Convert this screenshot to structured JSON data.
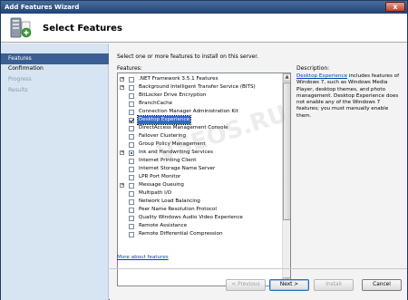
{
  "window": {
    "title": "Add Features Wizard",
    "close_glyph": "x"
  },
  "header": {
    "title": "Select Features",
    "icon": "server-add-feature-icon"
  },
  "nav": {
    "items": [
      {
        "label": "Features",
        "state": "active"
      },
      {
        "label": "Confirmation",
        "state": "normal"
      },
      {
        "label": "Progress",
        "state": "disabled"
      },
      {
        "label": "Results",
        "state": "disabled"
      }
    ]
  },
  "content": {
    "intro": "Select one or more features to install on this server.",
    "features_label": "Features:",
    "description_label": "Description:",
    "features": [
      {
        "label": ".NET Framework 3.5.1 Features",
        "expandable": true,
        "checked": false
      },
      {
        "label": "Background Intelligent Transfer Service (BITS)",
        "expandable": true,
        "checked": false
      },
      {
        "label": "BitLocker Drive Encryption",
        "expandable": false,
        "checked": false
      },
      {
        "label": "BranchCache",
        "expandable": false,
        "checked": false
      },
      {
        "label": "Connection Manager Administration Kit",
        "expandable": false,
        "checked": false
      },
      {
        "label": "Desktop Experience",
        "expandable": false,
        "checked": true,
        "selected": true
      },
      {
        "label": "DirectAccess Management Console",
        "expandable": false,
        "checked": false
      },
      {
        "label": "Failover Clustering",
        "expandable": false,
        "checked": false
      },
      {
        "label": "Group Policy Management",
        "expandable": false,
        "checked": false
      },
      {
        "label": "Ink and Handwriting Services",
        "expandable": true,
        "checked": false,
        "partial": true
      },
      {
        "label": "Internet Printing Client",
        "expandable": false,
        "checked": false
      },
      {
        "label": "Internet Storage Name Server",
        "expandable": false,
        "checked": false
      },
      {
        "label": "LPR Port Monitor",
        "expandable": false,
        "checked": false
      },
      {
        "label": "Message Queuing",
        "expandable": true,
        "checked": false
      },
      {
        "label": "Multipath I/O",
        "expandable": false,
        "checked": false
      },
      {
        "label": "Network Load Balancing",
        "expandable": false,
        "checked": false
      },
      {
        "label": "Peer Name Resolution Protocol",
        "expandable": false,
        "checked": false
      },
      {
        "label": "Quality Windows Audio Video Experience",
        "expandable": false,
        "checked": false
      },
      {
        "label": "Remote Assistance",
        "expandable": false,
        "checked": false
      },
      {
        "label": "Remote Differential Compression",
        "expandable": false,
        "checked": false
      }
    ],
    "description_link": "Desktop Experience",
    "description_text": " includes features of Windows 7, such as Windows Media Player, desktop themes, and photo management. Desktop Experience does not enable any of the Windows 7 features; you must manually enable them.",
    "more_link": "More about features"
  },
  "buttons": {
    "previous": "< Previous",
    "next": "Next >",
    "install": "Install",
    "cancel": "Cancel"
  },
  "watermark": "VSEOS.RU",
  "colors": {
    "nav_active": "#3b5f94",
    "nav_background": "#d7e4f2",
    "selection": "#3169c6",
    "link": "#0645ad"
  }
}
